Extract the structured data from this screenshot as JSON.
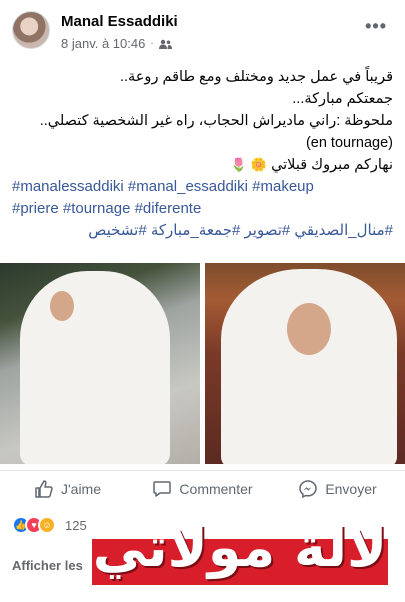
{
  "post": {
    "author": "Manal Essaddiki",
    "date": "8 janv. à 10:46",
    "audience_icon": "friends-icon",
    "more_label": "•••",
    "text_lines": [
      "قريباً في عمل جديد ومختلف ومع طاقم روعة..",
      "جمعتكم مباركة...",
      "ملحوظة :راني ماديراش الحجاب، راه غير الشخصية كتصلي..",
      "(en tournage)",
      "نهاركم مبروك قبلاتي"
    ],
    "emojis": [
      "sunflower",
      "tulip"
    ],
    "hashtags_line1": "#manalessaddiki #manal_essaddiki #makeup",
    "hashtags_line2": "#priere #tournage #diferente",
    "hashtags_line3": "#منال_الصديقي #تصوير #جمعة_مباركة #تشخيص",
    "link_color": "#385898"
  },
  "actions": {
    "like": "J'aime",
    "comment": "Commenter",
    "share": "Envoyer"
  },
  "reactions": {
    "count": "125"
  },
  "comments": {
    "link": "Afficher les"
  },
  "watermark": {
    "text": "لالة مولاتي",
    "color": "#d81e2b"
  }
}
